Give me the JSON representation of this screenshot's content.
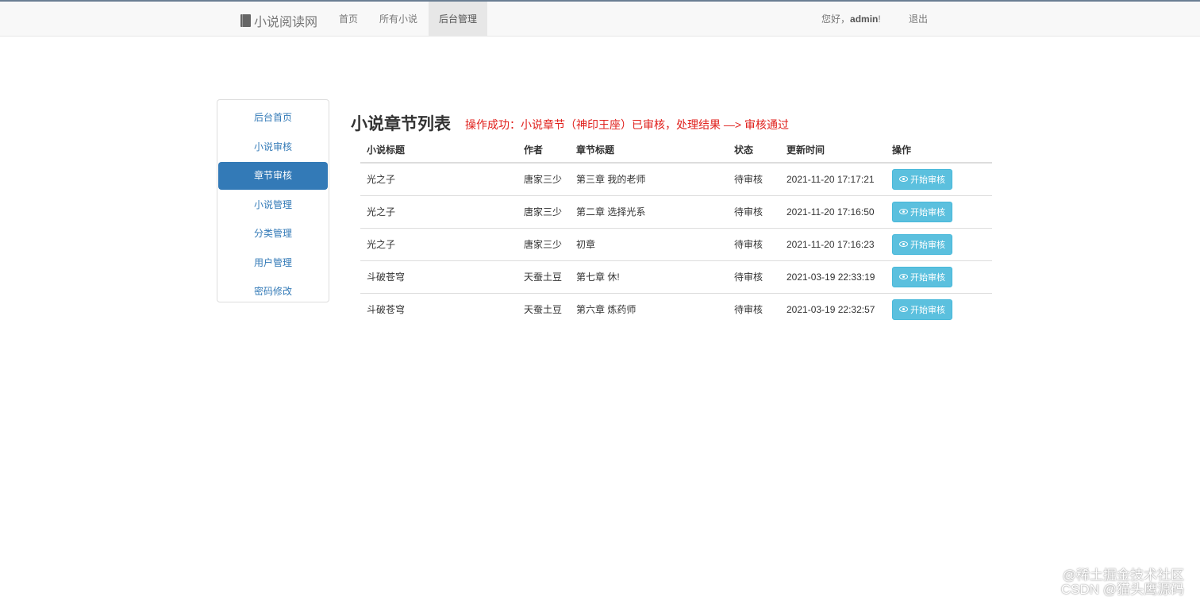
{
  "navbar": {
    "brand": "小说阅读网",
    "links": [
      {
        "label": "首页"
      },
      {
        "label": "所有小说"
      },
      {
        "label": "后台管理"
      }
    ],
    "greeting_prefix": "您好，",
    "username": "admin",
    "greeting_suffix": "!",
    "logout": "退出"
  },
  "sidebar": {
    "items": [
      {
        "label": "后台首页"
      },
      {
        "label": "小说审核"
      },
      {
        "label": "章节审核"
      },
      {
        "label": "小说管理"
      },
      {
        "label": "分类管理"
      },
      {
        "label": "用户管理"
      },
      {
        "label": "密码修改"
      }
    ]
  },
  "main": {
    "title": "小说章节列表",
    "message": "操作成功：小说章节（神印王座）已审核，处理结果 —> 审核通过",
    "table": {
      "headers": [
        "小说标题",
        "作者",
        "章节标题",
        "状态",
        "更新时间",
        "操作"
      ],
      "rows": [
        {
          "title": "光之子",
          "author": "唐家三少",
          "chapter": "第三章 我的老师",
          "status": "待审核",
          "time": "2021-11-20 17:17:21",
          "action": "开始审核"
        },
        {
          "title": "光之子",
          "author": "唐家三少",
          "chapter": "第二章 选择光系",
          "status": "待审核",
          "time": "2021-11-20 17:16:50",
          "action": "开始审核"
        },
        {
          "title": "光之子",
          "author": "唐家三少",
          "chapter": "初章",
          "status": "待审核",
          "time": "2021-11-20 17:16:23",
          "action": "开始审核"
        },
        {
          "title": "斗破苍穹",
          "author": "天蚕土豆",
          "chapter": "第七章 休!",
          "status": "待审核",
          "time": "2021-03-19 22:33:19",
          "action": "开始审核"
        },
        {
          "title": "斗破苍穹",
          "author": "天蚕土豆",
          "chapter": "第六章 炼药师",
          "status": "待审核",
          "time": "2021-03-19 22:32:57",
          "action": "开始审核"
        }
      ]
    }
  },
  "watermark": {
    "line1": "@稀土掘金技术社区",
    "line2": "CSDN @猫头鹰源码"
  },
  "colors": {
    "accent": "#337ab7",
    "info_button": "#5bc0de",
    "message": "#e0201c"
  }
}
